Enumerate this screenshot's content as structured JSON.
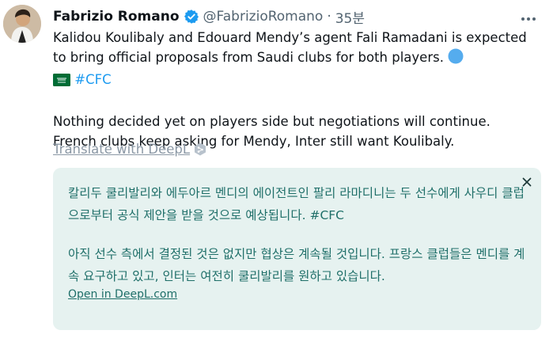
{
  "author": {
    "name": "Fabrizio Romano",
    "handle": "@FabrizioRomano",
    "separator": "·",
    "time": "35분"
  },
  "tweet": {
    "paragraph1": "Kalidou Koulibaly and Edouard Mendy’s agent Fali Ramadani is expected to bring official proposals from Saudi clubs for both players.",
    "hashtag": "#CFC",
    "paragraph2_line1": "Nothing decided yet on players side but negotiations will continue.",
    "paragraph2_line2": "French clubs keep asking for Mendy, Inter still want Koulibaly."
  },
  "translate": {
    "label": "Translate with DeepL"
  },
  "translation": {
    "paragraph1": "칼리두 쿨리발리와 에두아르 멘디의 에이전트인 팔리 라마디니는 두 선수에게 사우디 클럽으로부터 공식 제안을 받을 것으로 예상됩니다.",
    "hashtag": "#CFC",
    "paragraph2": "아직 선수 측에서 결정된 것은 없지만 협상은 계속될 것입니다. 프랑스 클럽들은 멘디를 계속 요구하고 있고, 인터는 여전히 쿨리발리를 원하고 있습니다.",
    "open_link": "Open in DeepL.com"
  },
  "colors": {
    "verified": "#1d9bf0",
    "hashtag": "#1d9bf0",
    "translation_bg": "#e6f2f0",
    "translation_text": "#1f6f69"
  },
  "icons": {
    "verified": "verified-badge-icon",
    "more": "more-horizontal-icon",
    "emoji_circle": "blue-circle-emoji-icon",
    "emoji_flag": "saudi-flag-emoji-icon",
    "deepl": "deepl-logo-icon",
    "close": "close-icon"
  }
}
